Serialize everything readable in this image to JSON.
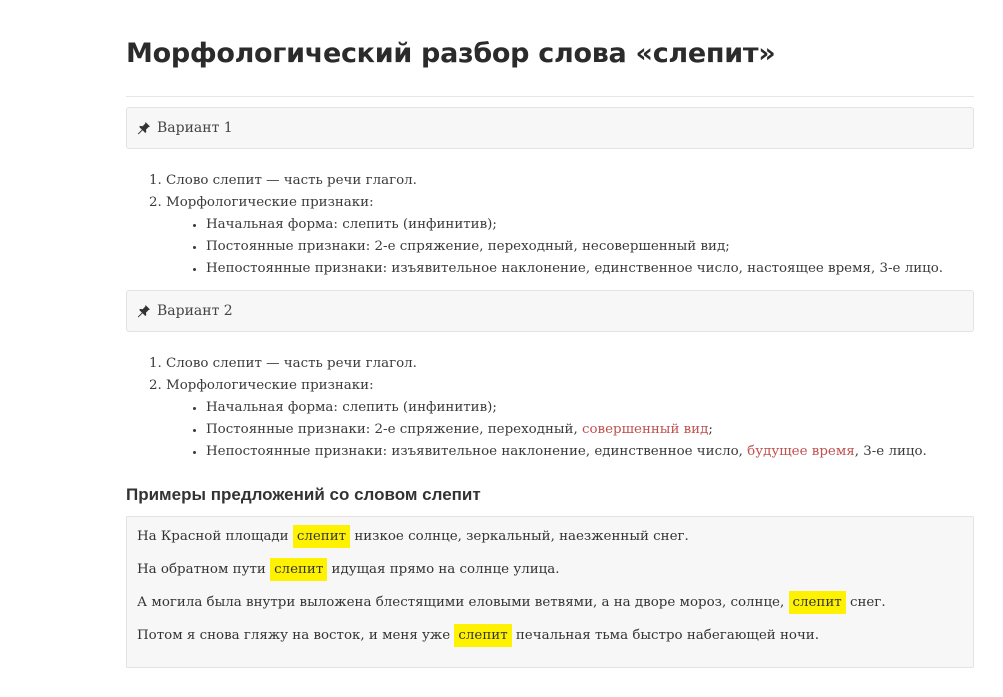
{
  "title": "Морфологический разбор слова «слепит»",
  "variants": [
    {
      "label": "Вариант 1",
      "items": {
        "part_of_speech": "Слово слепит — часть речи глагол.",
        "features_label": "Морфологические признаки:",
        "initial_form": "Начальная форма: слепить (инфинитив);",
        "constant_prefix": "Постоянные признаки: 2-е спряжение, переходный, ",
        "constant_marked": "несовершенный вид",
        "constant_suffix": ";",
        "variable_prefix": "Непостоянные признаки: изъявительное наклонение, единственное число, ",
        "variable_marked": "настоящее время",
        "variable_suffix": ", 3-е лицо."
      }
    },
    {
      "label": "Вариант 2",
      "items": {
        "part_of_speech": "Слово слепит — часть речи глагол.",
        "features_label": "Морфологические признаки:",
        "initial_form": "Начальная форма: слепить (инфинитив);",
        "constant_prefix": "Постоянные признаки: 2-е спряжение, переходный, ",
        "constant_marked": "совершенный вид",
        "constant_suffix": ";",
        "variable_prefix": "Непостоянные признаки: изъявительное наклонение, единственное число, ",
        "variable_marked": "будущее время",
        "variable_suffix": ", 3-е лицо."
      }
    }
  ],
  "examples_heading": "Примеры предложений со словом слепит",
  "highlight_word": "слепит",
  "examples": [
    {
      "before": "На Красной площади ",
      "after": " низкое солнце, зеркальный, наезженный снег."
    },
    {
      "before": "На обратном пути ",
      "after": " идущая прямо на солнце улица."
    },
    {
      "before": "А могила была внутри выложена блестящими еловыми ветвями, а на дворе мороз, солнце, ",
      "after": " снег."
    },
    {
      "before": "Потом я снова гляжу на восток, и меня уже ",
      "after": " печальная тьма быстро набегающей ночи."
    }
  ],
  "colors": {
    "highlight": "#fff200",
    "changed_feature": "#c0504d",
    "panel_bg": "#f7f7f7"
  },
  "icons": {
    "variant": "pushpin-icon"
  }
}
